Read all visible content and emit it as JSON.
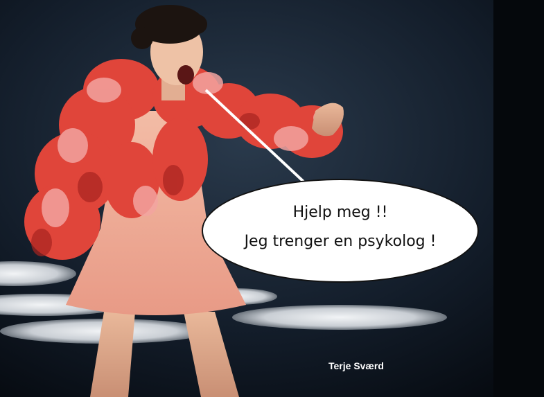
{
  "speech_bubble": {
    "line1": "Hjelp meg !!",
    "line2": "Jeg trenger en psykolog !"
  },
  "credit": "Terje Sværd",
  "colors": {
    "stage_background": "#0b1420",
    "jacket_red": "#e0453a",
    "jacket_pink": "#f2a3a0",
    "dress_pink": "#f0b09a",
    "bubble_fill": "#ffffff",
    "bubble_text": "#111111",
    "credit_text": "#ffffff"
  }
}
